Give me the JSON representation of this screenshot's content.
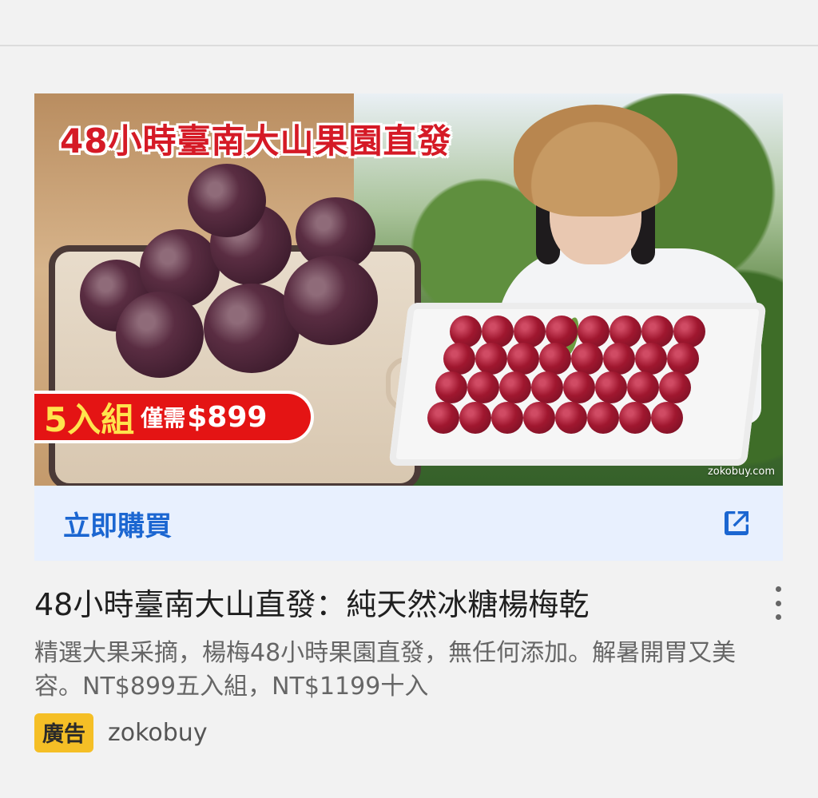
{
  "banner": {
    "headline": "48小時臺南大山果園直發",
    "offer_set": "5入組",
    "offer_only": "僅需",
    "offer_price": "$899",
    "watermark": "zokobuy.com"
  },
  "cta": {
    "label": "立即購買",
    "icon": "external-link-icon"
  },
  "listing": {
    "title": "48小時臺南大山直發：純天然冰糖楊梅乾",
    "description": "精選大果采摘，楊梅48小時果園直發，無任何添加。解暑開胃又美容。NT$899五入組，NT$1199十入",
    "ad_label": "廣告",
    "advertiser": "zokobuy"
  },
  "colors": {
    "background": "#f2f2f2",
    "cta_bg": "#e8f0fe",
    "cta_text": "#1b66d1",
    "badge": "#f5bf26"
  }
}
